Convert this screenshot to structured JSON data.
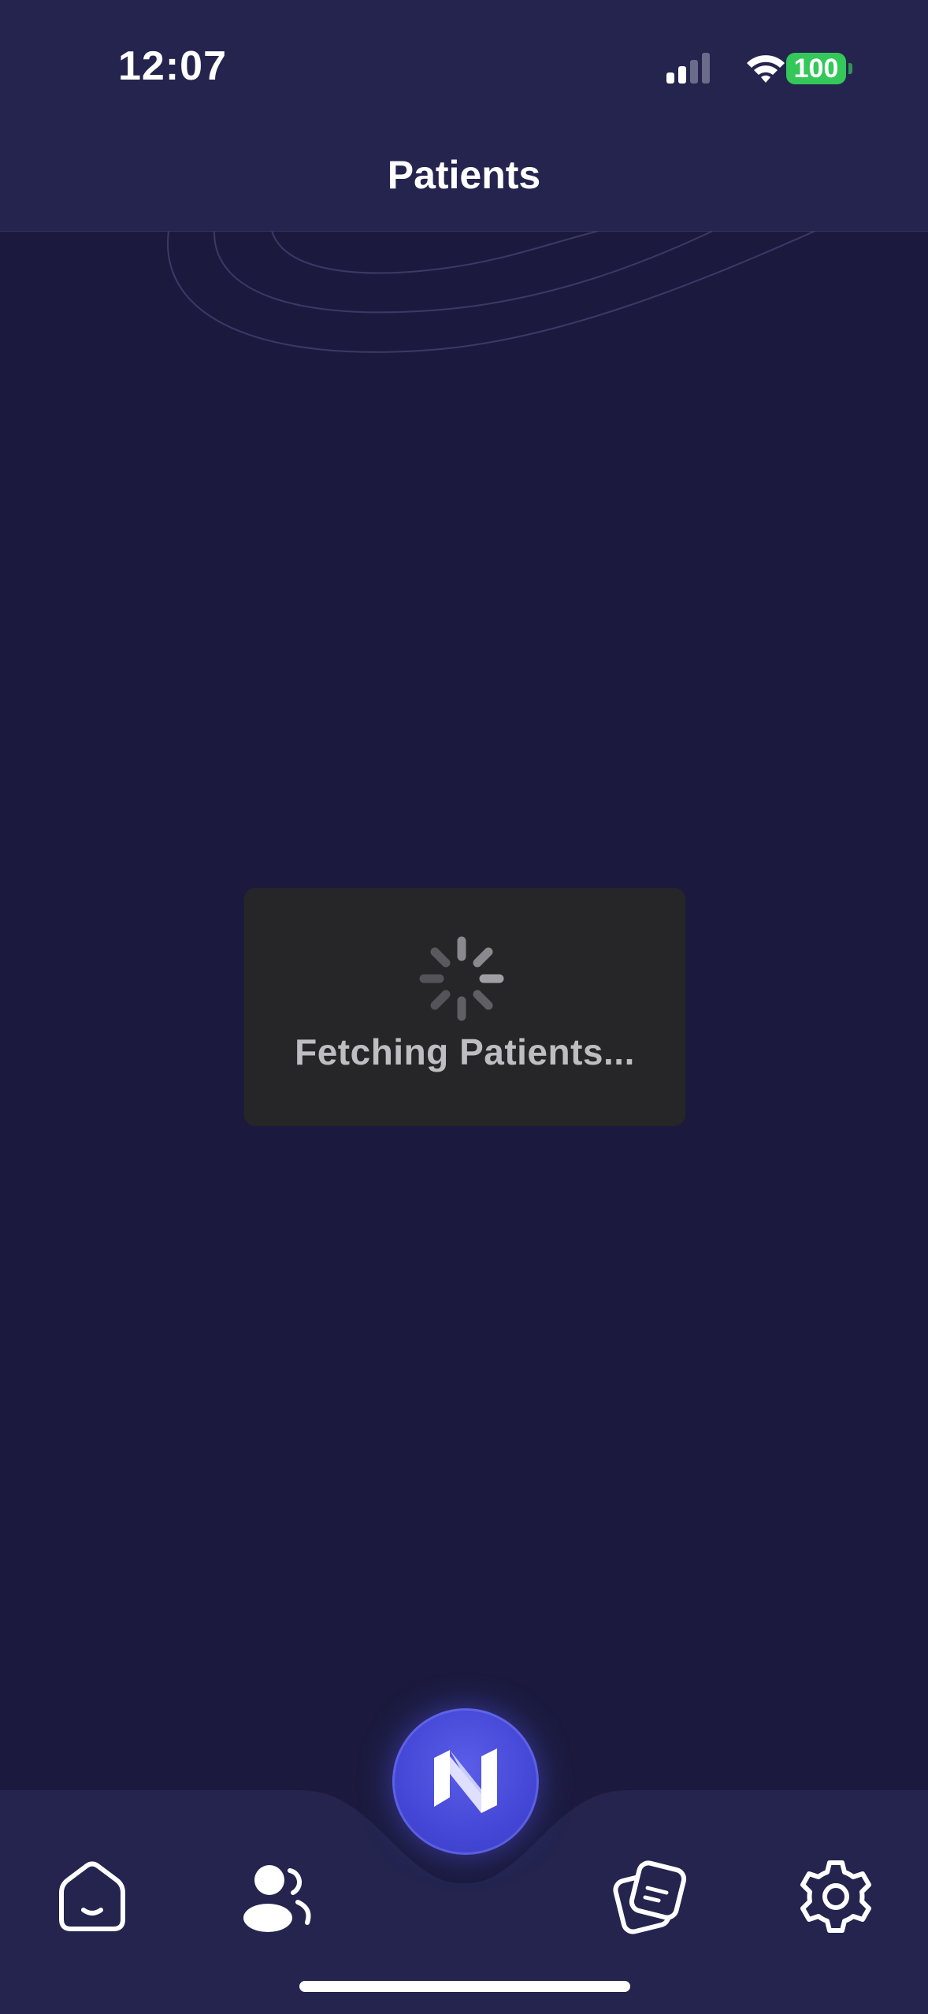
{
  "status_bar": {
    "time": "12:07",
    "battery": "100",
    "icons": [
      "signal-icon",
      "wifi-icon",
      "battery-icon"
    ],
    "battery_color": "#34c759"
  },
  "header": {
    "title": "Patients"
  },
  "loading": {
    "message": "Fetching Patients...",
    "icon": "spinner-icon"
  },
  "tab_bar": {
    "items": [
      {
        "name": "home",
        "icon": "home-smile-icon"
      },
      {
        "name": "patients",
        "icon": "users-icon",
        "selected": true
      },
      {
        "name": "assistant",
        "icon": "n-logo-icon"
      },
      {
        "name": "notes",
        "icon": "notes-icon"
      },
      {
        "name": "settings",
        "icon": "gear-icon"
      }
    ]
  },
  "colors": {
    "background": "#1b1a3e",
    "header": "#24244f",
    "accent": "#4447d6"
  }
}
